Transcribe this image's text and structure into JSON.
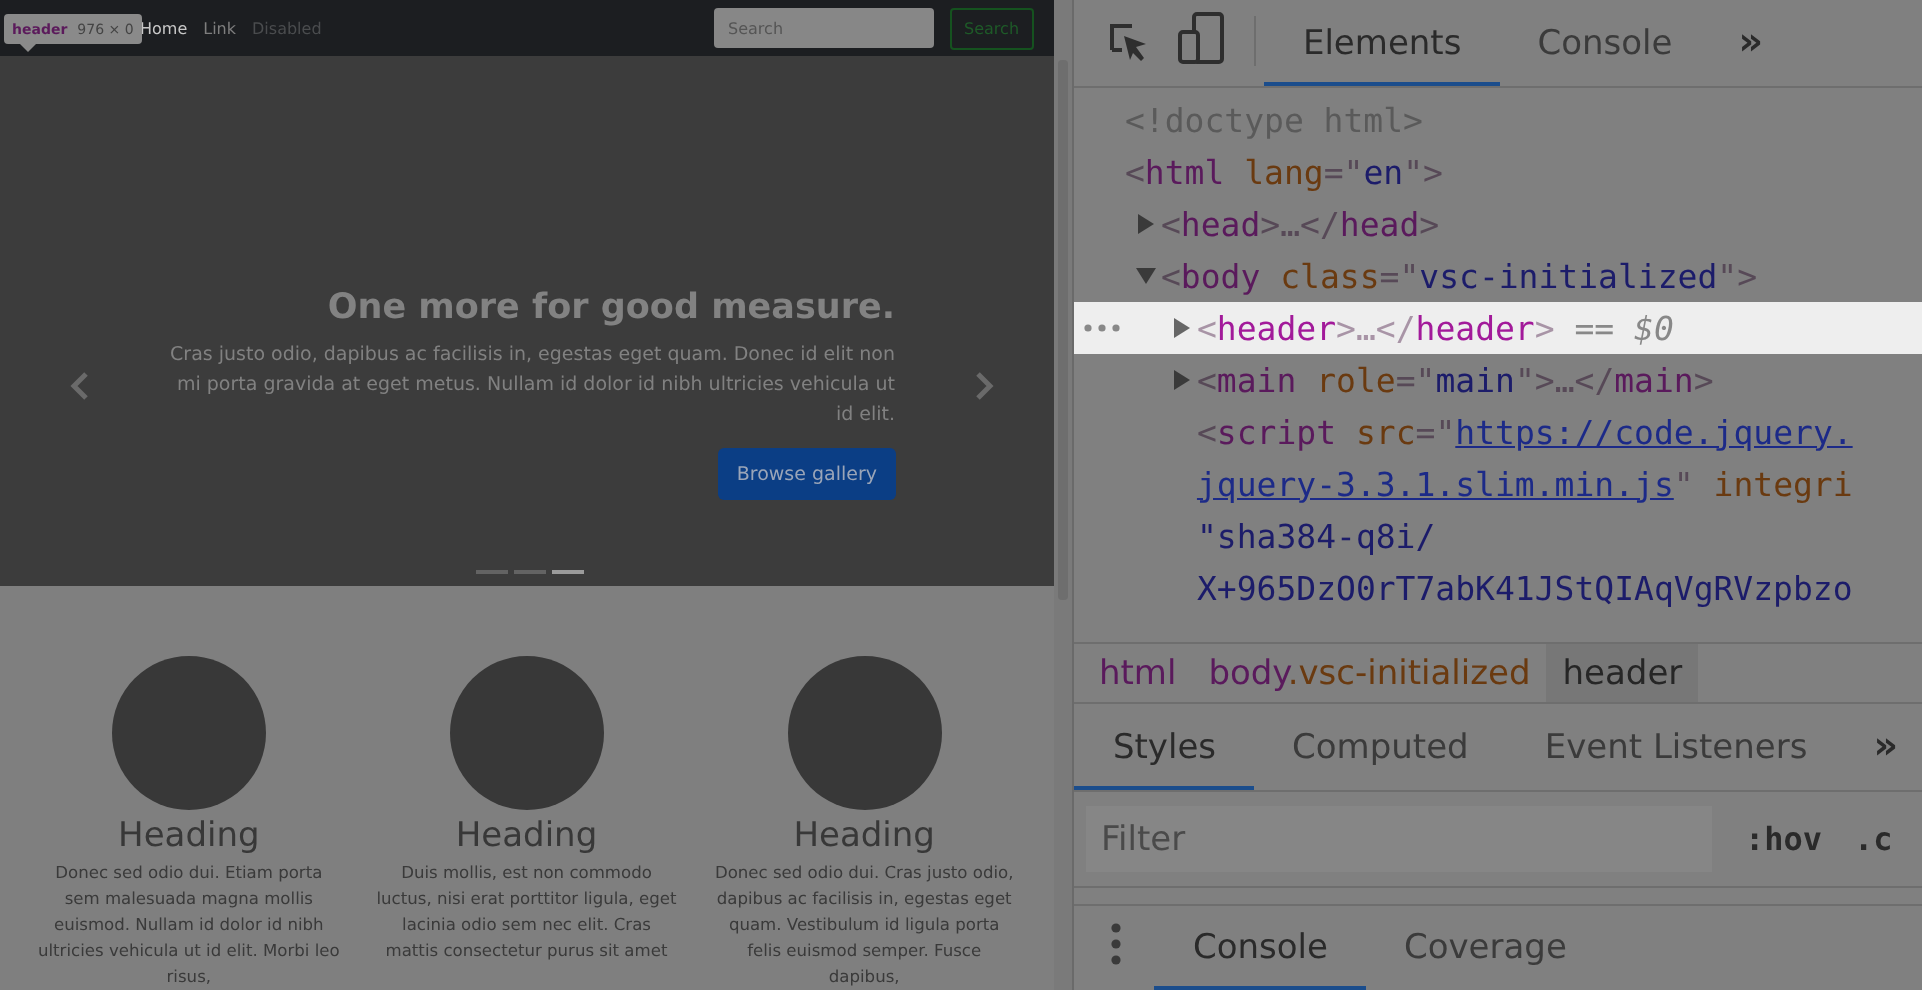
{
  "page": {
    "header_badge": {
      "tag": "header",
      "size": "976 × 0"
    },
    "nav": {
      "links": [
        {
          "label": "Home",
          "active": true,
          "disabled": false
        },
        {
          "label": "Link",
          "active": false,
          "disabled": false
        },
        {
          "label": "Disabled",
          "active": false,
          "disabled": true
        }
      ],
      "search": {
        "placeholder": "Search"
      },
      "search_button": "Search"
    },
    "carousel": {
      "title": "One more for good measure.",
      "text": "Cras justo odio, dapibus ac facilisis in, egestas eget quam. Donec id elit non mi porta gravida at eget metus. Nullam id dolor id nibh ultricies vehicula ut id elit.",
      "button": "Browse gallery",
      "indicators": [
        {
          "selected": false
        },
        {
          "selected": false
        },
        {
          "selected": true
        }
      ]
    },
    "columns": [
      {
        "heading": "Heading",
        "text": "Donec sed odio dui. Etiam porta sem malesuada magna mollis euismod. Nullam id dolor id nibh ultricies vehicula ut id elit. Morbi leo risus,"
      },
      {
        "heading": "Heading",
        "text": "Duis mollis, est non commodo luctus, nisi erat porttitor ligula, eget lacinia odio sem nec elit. Cras mattis consectetur purus sit amet"
      },
      {
        "heading": "Heading",
        "text": "Donec sed odio dui. Cras justo odio, dapibus ac facilisis in, egestas eget quam. Vestibulum id ligula porta felis euismod semper. Fusce dapibus,"
      }
    ]
  },
  "devtools": {
    "tabs": [
      {
        "label": "Elements",
        "selected": true
      },
      {
        "label": "Console",
        "selected": false
      }
    ],
    "more": "»",
    "tree": [
      {
        "selected": false,
        "lines": [
          [
            {
              "kind": "doctype",
              "text": "<!doctype html>"
            }
          ]
        ]
      },
      {
        "selected": false,
        "lines": [
          [
            {
              "kind": "punct",
              "text": "<"
            },
            {
              "kind": "tag",
              "text": "html"
            },
            {
              "kind": "attr",
              "text": " lang"
            },
            {
              "kind": "punct",
              "text": "=\""
            },
            {
              "kind": "value",
              "text": "en"
            },
            {
              "kind": "punct",
              "text": "\">"
            }
          ]
        ],
        "children": [
          {
            "selected": false,
            "expanded": false,
            "lines": [
              [
                {
                  "kind": "punct",
                  "text": "<"
                },
                {
                  "kind": "tag",
                  "text": "head"
                },
                {
                  "kind": "punct",
                  "text": ">…</"
                },
                {
                  "kind": "tag",
                  "text": "head"
                },
                {
                  "kind": "punct",
                  "text": ">"
                }
              ]
            ]
          },
          {
            "selected": false,
            "expanded": true,
            "lines": [
              [
                {
                  "kind": "punct",
                  "text": "<"
                },
                {
                  "kind": "tag",
                  "text": "body"
                },
                {
                  "kind": "attr",
                  "text": " class"
                },
                {
                  "kind": "punct",
                  "text": "=\""
                },
                {
                  "kind": "value",
                  "text": "vsc-initialized"
                },
                {
                  "kind": "punct",
                  "text": "\">"
                }
              ]
            ],
            "children": [
              {
                "selected": true,
                "expanded": false,
                "lines": [
                  [
                    {
                      "kind": "punct",
                      "text": "<"
                    },
                    {
                      "kind": "tag",
                      "text": "header"
                    },
                    {
                      "kind": "punct",
                      "text": ">…</"
                    },
                    {
                      "kind": "tag",
                      "text": "header"
                    },
                    {
                      "kind": "punct",
                      "text": ">"
                    },
                    {
                      "kind": "marker",
                      "text": " == $0"
                    }
                  ]
                ]
              },
              {
                "selected": false,
                "expanded": false,
                "lines": [
                  [
                    {
                      "kind": "punct",
                      "text": "<"
                    },
                    {
                      "kind": "tag",
                      "text": "main"
                    },
                    {
                      "kind": "attr",
                      "text": " role"
                    },
                    {
                      "kind": "punct",
                      "text": "=\""
                    },
                    {
                      "kind": "value",
                      "text": "main"
                    },
                    {
                      "kind": "punct",
                      "text": "\">…</"
                    },
                    {
                      "kind": "tag",
                      "text": "main"
                    },
                    {
                      "kind": "punct",
                      "text": ">"
                    }
                  ]
                ]
              },
              {
                "selected": false,
                "lines": [
                  [
                    {
                      "kind": "punct",
                      "text": "<"
                    },
                    {
                      "kind": "tag",
                      "text": "script"
                    },
                    {
                      "kind": "attr",
                      "text": " src"
                    },
                    {
                      "kind": "punct",
                      "text": "=\""
                    },
                    {
                      "kind": "link",
                      "text": "https://code.jquery."
                    }
                  ],
                  [
                    {
                      "kind": "link",
                      "text": "jquery-3.3.1.slim.min.js"
                    },
                    {
                      "kind": "punct",
                      "text": "\""
                    },
                    {
                      "kind": "attr",
                      "text": " integri"
                    }
                  ],
                  [
                    {
                      "kind": "value",
                      "text": "\"sha384-q8i/"
                    }
                  ],
                  [
                    {
                      "kind": "value",
                      "text": "X+965DzO0rT7abK41JStQIAqVgRVzpbzo"
                    }
                  ]
                ]
              }
            ]
          }
        ]
      }
    ],
    "breadcrumbs": [
      {
        "tag": "html",
        "selected": false
      },
      {
        "tag": "body",
        "class_name": ".vsc-initialized",
        "selected": false
      },
      {
        "tag": "header",
        "selected": true
      }
    ],
    "styles_tabs": [
      {
        "label": "Styles",
        "selected": true
      },
      {
        "label": "Computed",
        "selected": false
      },
      {
        "label": "Event Listeners",
        "selected": false
      }
    ],
    "filter": {
      "placeholder": "Filter"
    },
    "hov": ":hov",
    "cls": ".c",
    "drawer_tabs": [
      {
        "label": "Console",
        "selected": true
      },
      {
        "label": "Coverage",
        "selected": false
      }
    ]
  }
}
